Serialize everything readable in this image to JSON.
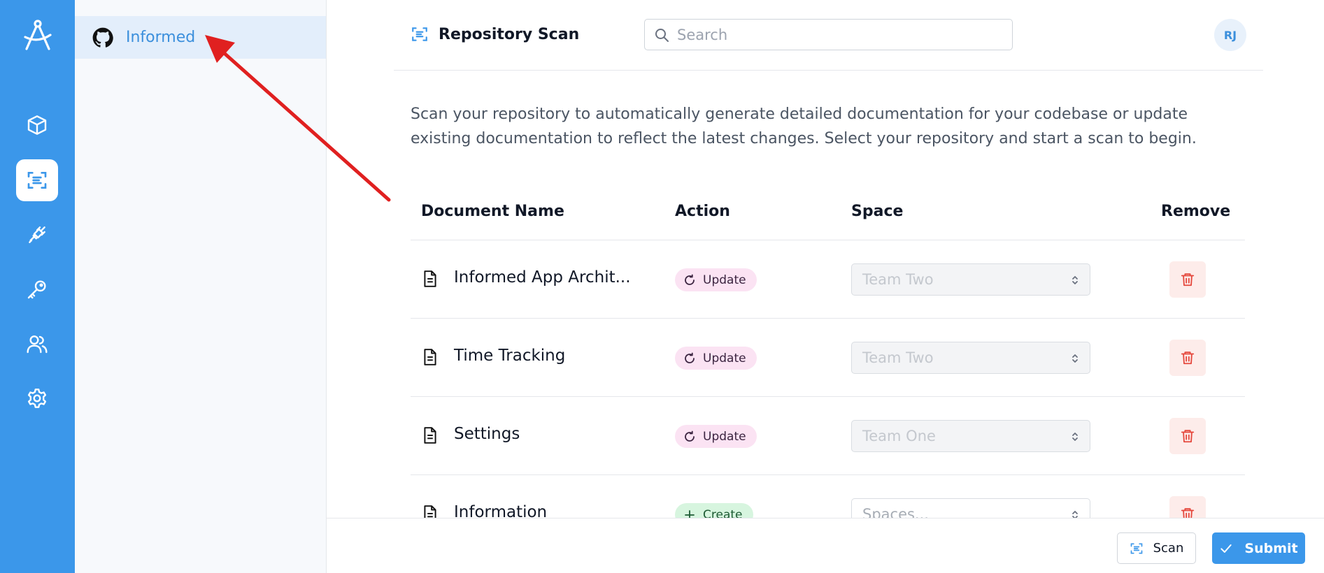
{
  "sidebar": {
    "repositories": [
      {
        "name": "Informed",
        "icon": "github-icon"
      }
    ]
  },
  "rail": {
    "items": [
      {
        "icon": "cube-icon",
        "active": false
      },
      {
        "icon": "scan-icon",
        "active": true
      },
      {
        "icon": "plug-icon",
        "active": false
      },
      {
        "icon": "key-icon",
        "active": false
      },
      {
        "icon": "users-icon",
        "active": false
      },
      {
        "icon": "gear-icon",
        "active": false
      }
    ]
  },
  "header": {
    "title": "Repository Scan",
    "search_placeholder": "Search",
    "avatar_initials": "RJ"
  },
  "description": "Scan your repository to automatically generate detailed documentation for your codebase or update existing documentation to reflect the latest changes. Select your repository and start a scan to begin.",
  "table": {
    "columns": [
      "Document Name",
      "Action",
      "Space",
      "Remove"
    ],
    "rows": [
      {
        "name": "Informed App Archit...",
        "action": "Update",
        "space": "Team Two"
      },
      {
        "name": "Time Tracking",
        "action": "Update",
        "space": "Team Two"
      },
      {
        "name": "Settings",
        "action": "Update",
        "space": "Team One"
      },
      {
        "name": "Information",
        "action": "Create",
        "space": "Spaces..."
      }
    ]
  },
  "footer": {
    "scan_label": "Scan",
    "submit_label": "Submit"
  },
  "colors": {
    "brand": "#3b97ea",
    "update_badge": "#fbe3f3",
    "create_badge": "#d7f5df",
    "danger": "#e5483d",
    "annotation_arrow": "#e02020"
  }
}
